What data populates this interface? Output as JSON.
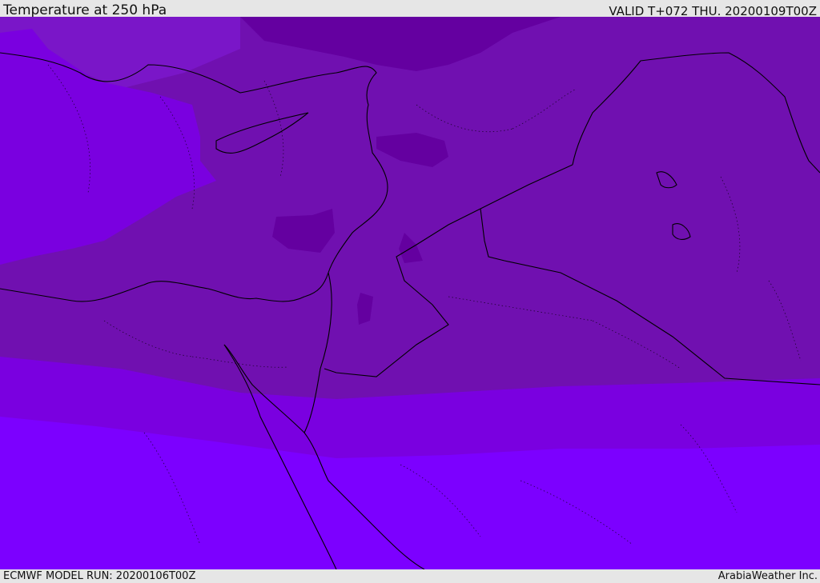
{
  "header": {
    "title": "Temperature at 250 hPa",
    "valid": "VALID T+072 THU. 20200109T00Z"
  },
  "footer": {
    "model_run": "ECMWF MODEL RUN: 20200106T00Z",
    "credit": "ArabiaWeather Inc."
  },
  "colors": {
    "band_coldest": "#6400a0",
    "band_cold": "#7010b0",
    "band_mid": "#7a16c8",
    "band_warm": "#7a00e0",
    "band_warmest": "#7c00ff",
    "coastline": "#000000",
    "header_background": "#e6e6e6"
  }
}
